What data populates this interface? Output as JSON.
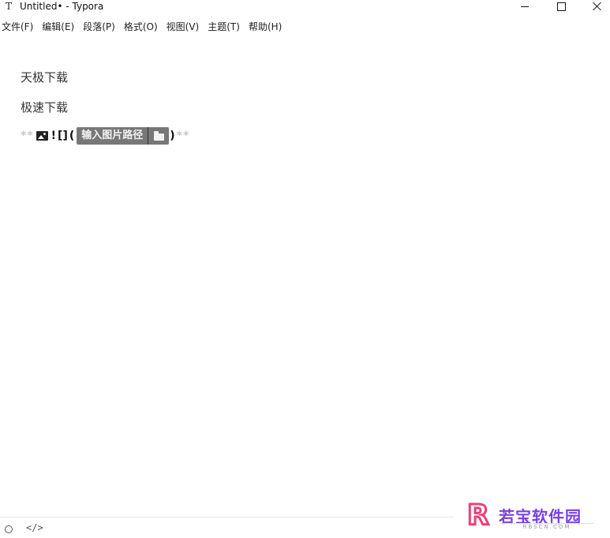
{
  "window": {
    "title": "Untitled• - Typora",
    "app_icon": "T"
  },
  "menu": [
    {
      "label": "文件(F)"
    },
    {
      "label": "编辑(E)"
    },
    {
      "label": "段落(P)"
    },
    {
      "label": "格式(O)"
    },
    {
      "label": "视图(V)"
    },
    {
      "label": "主题(T)"
    },
    {
      "label": "帮助(H)"
    }
  ],
  "editor": {
    "paragraphs": [
      "天极下载",
      "极速下载"
    ],
    "markdown_line": {
      "prefix_stars": "**",
      "bang": "!",
      "brackets": "[]",
      "open_paren": "(",
      "path_placeholder": "输入图片路径",
      "close_paren": ")",
      "suffix_stars": "**"
    }
  },
  "statusbar": {
    "code_toggle": "</>"
  },
  "watermark": {
    "letter": "R",
    "text": "若宝软件园",
    "sub": "RBSCN.COM"
  }
}
